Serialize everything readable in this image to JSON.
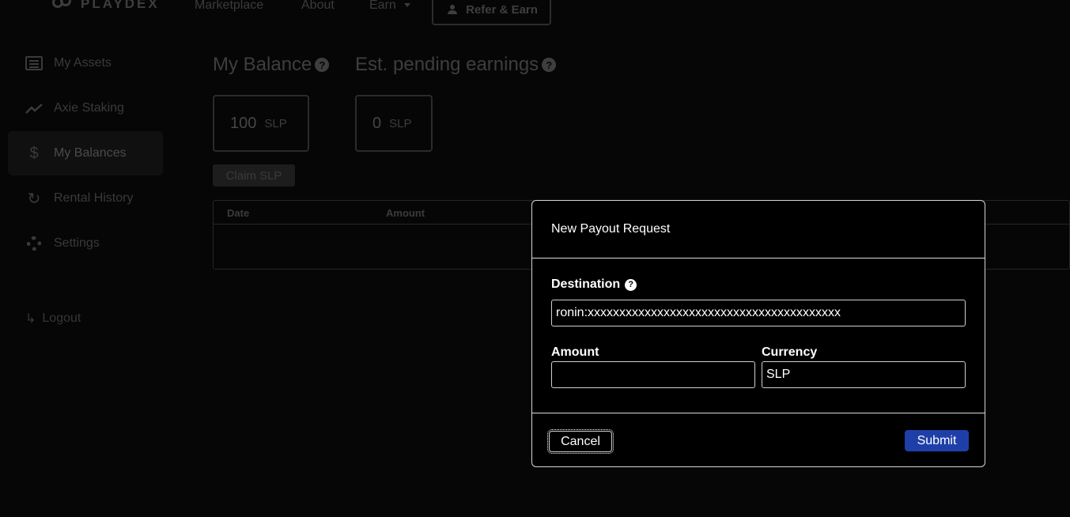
{
  "nav": {
    "logo_text": "PLAYDEX",
    "links": {
      "marketplace": "Marketplace",
      "about": "About",
      "earn": "Earn"
    },
    "refer_label": "Refer & Earn"
  },
  "sidebar": {
    "items": [
      {
        "label": "My Assets",
        "icon": "list-icon"
      },
      {
        "label": "Axie Staking",
        "icon": "trending-up-icon"
      },
      {
        "label": "My Balances",
        "icon": "dollar-icon",
        "active": true
      },
      {
        "label": "Rental History",
        "icon": "history-icon"
      },
      {
        "label": "Settings",
        "icon": "gear-icon"
      }
    ],
    "logout": "Logout"
  },
  "main": {
    "balance_title": "My Balance",
    "pending_title": "Est. pending earnings",
    "balance_value": "100",
    "balance_unit": "SLP",
    "pending_value": "0",
    "pending_unit": "SLP",
    "claim_label": "Claim SLP",
    "table_headers": [
      "Date",
      "Amount"
    ]
  },
  "modal": {
    "title": "New Payout Request",
    "destination_label": "Destination",
    "destination_value": "ronin:xxxxxxxxxxxxxxxxxxxxxxxxxxxxxxxxxxxxxxxx",
    "amount_label": "Amount",
    "amount_value": "",
    "currency_label": "Currency",
    "currency_value": "SLP",
    "cancel_label": "Cancel",
    "submit_label": "Submit"
  },
  "colors": {
    "accent": "#1f3fa8",
    "background": "#060606",
    "modal_border": "#d6d6d6"
  }
}
